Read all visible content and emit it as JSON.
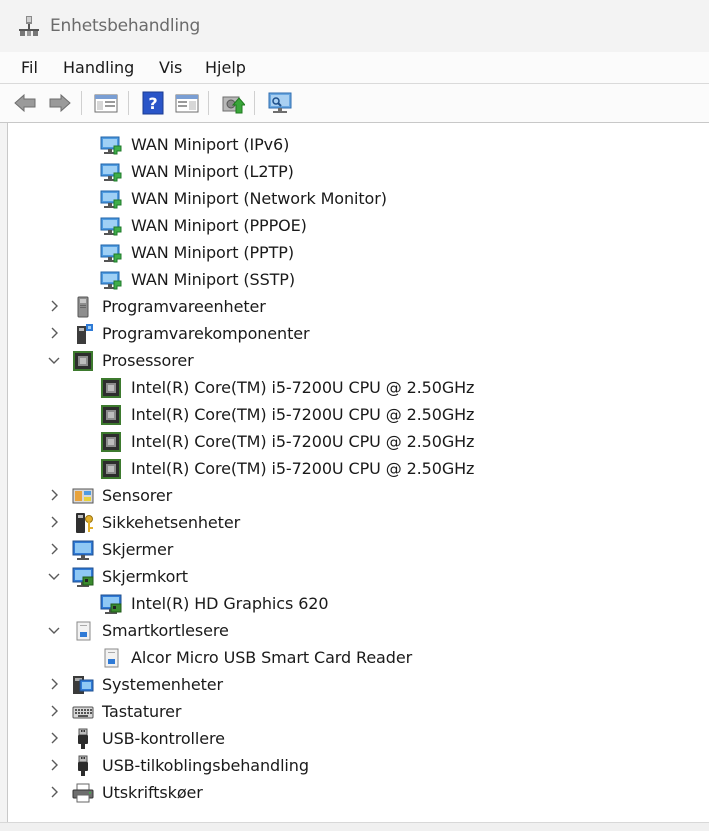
{
  "window": {
    "title": "Enhetsbehandling",
    "app_icon": "device-manager-icon"
  },
  "menu": [
    {
      "label": "Fil"
    },
    {
      "label": "Handling"
    },
    {
      "label": "Vis"
    },
    {
      "label": "Hjelp"
    }
  ],
  "toolbar": {
    "buttons": [
      "back-arrow-icon",
      "forward-arrow-icon",
      "show-hide-console-tree-icon",
      "help-icon",
      "properties-icon",
      "update-driver-icon",
      "scan-hardware-changes-icon"
    ]
  },
  "tree": {
    "rows": [
      {
        "label": "WAN Miniport (IPv6)",
        "level": 2,
        "icon": "network-adapter-icon"
      },
      {
        "label": "WAN Miniport (L2TP)",
        "level": 2,
        "icon": "network-adapter-icon"
      },
      {
        "label": "WAN Miniport (Network Monitor)",
        "level": 2,
        "icon": "network-adapter-icon"
      },
      {
        "label": "WAN Miniport (PPPOE)",
        "level": 2,
        "icon": "network-adapter-icon"
      },
      {
        "label": "WAN Miniport (PPTP)",
        "level": 2,
        "icon": "network-adapter-icon"
      },
      {
        "label": "WAN Miniport (SSTP)",
        "level": 2,
        "icon": "network-adapter-icon"
      },
      {
        "label": "Programvareenheter",
        "level": 1,
        "expanded": false,
        "icon": "software-device-icon"
      },
      {
        "label": "Programvarekomponenter",
        "level": 1,
        "expanded": false,
        "icon": "software-component-icon"
      },
      {
        "label": "Prosessorer",
        "level": 1,
        "expanded": true,
        "icon": "processor-icon"
      },
      {
        "label": "Intel(R) Core(TM) i5-7200U CPU @ 2.50GHz",
        "level": 2,
        "icon": "processor-icon"
      },
      {
        "label": "Intel(R) Core(TM) i5-7200U CPU @ 2.50GHz",
        "level": 2,
        "icon": "processor-icon"
      },
      {
        "label": "Intel(R) Core(TM) i5-7200U CPU @ 2.50GHz",
        "level": 2,
        "icon": "processor-icon"
      },
      {
        "label": "Intel(R) Core(TM) i5-7200U CPU @ 2.50GHz",
        "level": 2,
        "icon": "processor-icon"
      },
      {
        "label": "Sensorer",
        "level": 1,
        "expanded": false,
        "icon": "sensor-icon"
      },
      {
        "label": "Sikkehetsenheter",
        "level": 1,
        "expanded": false,
        "icon": "security-device-icon"
      },
      {
        "label": "Skjermer",
        "level": 1,
        "expanded": false,
        "icon": "monitor-icon"
      },
      {
        "label": "Skjermkort",
        "level": 1,
        "expanded": true,
        "icon": "display-adapter-icon"
      },
      {
        "label": "Intel(R) HD Graphics 620",
        "level": 2,
        "icon": "display-adapter-icon"
      },
      {
        "label": "Smartkortlesere",
        "level": 1,
        "expanded": true,
        "icon": "smart-card-reader-icon"
      },
      {
        "label": "Alcor Micro USB Smart Card Reader",
        "level": 2,
        "icon": "smart-card-reader-icon"
      },
      {
        "label": "Systemenheter",
        "level": 1,
        "expanded": false,
        "icon": "system-device-icon"
      },
      {
        "label": "Tastaturer",
        "level": 1,
        "expanded": false,
        "icon": "keyboard-icon"
      },
      {
        "label": "USB-kontrollere",
        "level": 1,
        "expanded": false,
        "icon": "usb-icon"
      },
      {
        "label": "USB-tilkoblingsbehandling",
        "level": 1,
        "expanded": false,
        "icon": "usb-icon"
      },
      {
        "label": "Utskriftskøer",
        "level": 1,
        "expanded": false,
        "icon": "printer-icon"
      }
    ]
  }
}
